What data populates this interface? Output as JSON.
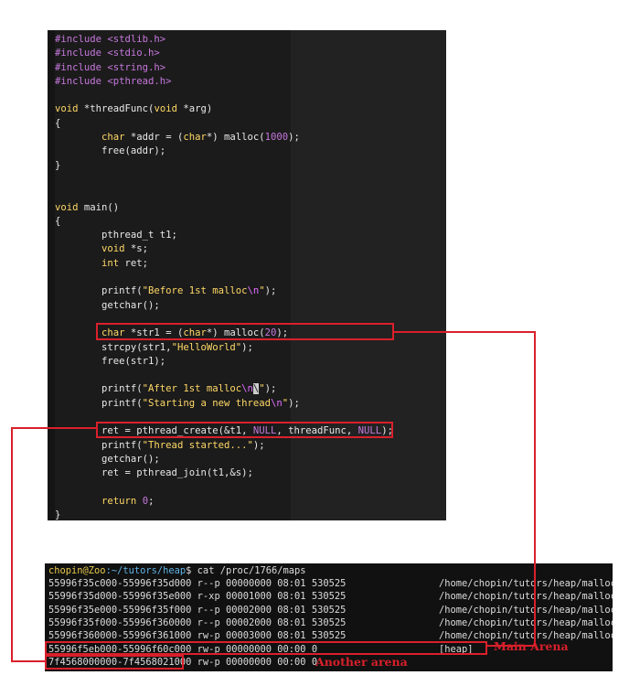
{
  "code_lines": [
    [
      [
        "pre",
        "#include "
      ],
      [
        "hdr",
        "<stdlib.h>"
      ]
    ],
    [
      [
        "pre",
        "#include "
      ],
      [
        "hdr",
        "<stdio.h>"
      ]
    ],
    [
      [
        "pre",
        "#include "
      ],
      [
        "hdr",
        "<string.h>"
      ]
    ],
    [
      [
        "pre",
        "#include "
      ],
      [
        "hdr",
        "<pthread.h>"
      ]
    ],
    [],
    [
      [
        "kw",
        "void"
      ],
      [
        "plain",
        " *threadFunc("
      ],
      [
        "kw",
        "void"
      ],
      [
        "plain",
        " *arg)"
      ]
    ],
    [
      [
        "plain",
        "{"
      ]
    ],
    [
      [
        "plain",
        "        "
      ],
      [
        "type",
        "char"
      ],
      [
        "plain",
        " *addr = ("
      ],
      [
        "type",
        "char"
      ],
      [
        "plain",
        "*) malloc("
      ],
      [
        "num",
        "1000"
      ],
      [
        "plain",
        ");"
      ]
    ],
    [
      [
        "plain",
        "        free(addr);"
      ]
    ],
    [
      [
        "plain",
        "}"
      ]
    ],
    [],
    [],
    [
      [
        "kw",
        "void"
      ],
      [
        "plain",
        " main()"
      ]
    ],
    [
      [
        "plain",
        "{"
      ]
    ],
    [
      [
        "plain",
        "        pthread_t t1;"
      ]
    ],
    [
      [
        "plain",
        "        "
      ],
      [
        "kw",
        "void"
      ],
      [
        "plain",
        " *s;"
      ]
    ],
    [
      [
        "plain",
        "        "
      ],
      [
        "kw",
        "int"
      ],
      [
        "plain",
        " ret;"
      ]
    ],
    [],
    [
      [
        "plain",
        "        printf("
      ],
      [
        "str",
        "\"Before 1st malloc"
      ],
      [
        "esc",
        "\\n"
      ],
      [
        "str",
        "\""
      ],
      [
        "plain",
        ");"
      ]
    ],
    [
      [
        "plain",
        "        getchar();"
      ]
    ],
    [],
    [
      [
        "plain",
        "        "
      ],
      [
        "type",
        "char"
      ],
      [
        "plain",
        " *str1 = ("
      ],
      [
        "type",
        "char"
      ],
      [
        "plain",
        "*) malloc("
      ],
      [
        "num",
        "20"
      ],
      [
        "plain",
        ");"
      ]
    ],
    [
      [
        "plain",
        "        strcpy(str1,"
      ],
      [
        "str",
        "\"HelloWorld\""
      ],
      [
        "plain",
        ");"
      ]
    ],
    [
      [
        "plain",
        "        free(str1);"
      ]
    ],
    [],
    [
      [
        "plain",
        "        printf("
      ],
      [
        "str",
        "\"After 1st malloc"
      ],
      [
        "esc",
        "\\n"
      ],
      [
        "cursor",
        "\\"
      ],
      [
        "str",
        "\""
      ],
      [
        "plain",
        ");"
      ]
    ],
    [
      [
        "plain",
        "        printf("
      ],
      [
        "str",
        "\"Starting a new thread"
      ],
      [
        "esc",
        "\\n"
      ],
      [
        "str",
        "\""
      ],
      [
        "plain",
        ");"
      ]
    ],
    [],
    [
      [
        "plain",
        "        ret = pthread_create(&t1, "
      ],
      [
        "nul",
        "NULL"
      ],
      [
        "plain",
        ", threadFunc, "
      ],
      [
        "nul",
        "NULL"
      ],
      [
        "plain",
        ");"
      ]
    ],
    [
      [
        "plain",
        "        printf("
      ],
      [
        "str",
        "\"Thread started...\""
      ],
      [
        "plain",
        ");"
      ]
    ],
    [
      [
        "plain",
        "        getchar();"
      ]
    ],
    [
      [
        "plain",
        "        ret = pthread_join(t1,&s);"
      ]
    ],
    [],
    [
      [
        "plain",
        "        "
      ],
      [
        "kw",
        "return"
      ],
      [
        "plain",
        " "
      ],
      [
        "num",
        "0"
      ],
      [
        "plain",
        ";"
      ]
    ],
    [
      [
        "plain",
        "}"
      ]
    ]
  ],
  "terminal": {
    "prompt_user": "chopin@Zoo",
    "prompt_path": ":~/tutors/heap",
    "prompt_end": "$",
    "command": " cat /proc/1766/maps",
    "rows": [
      {
        "range": "55996f35c000-55996f35d000",
        "perms": "r--p",
        "offset": "00000000",
        "dev": "08:01",
        "inode": "530525",
        "path": "/home/chopin/tutors/heap/malloc"
      },
      {
        "range": "55996f35d000-55996f35e000",
        "perms": "r-xp",
        "offset": "00001000",
        "dev": "08:01",
        "inode": "530525",
        "path": "/home/chopin/tutors/heap/malloc"
      },
      {
        "range": "55996f35e000-55996f35f000",
        "perms": "r--p",
        "offset": "00002000",
        "dev": "08:01",
        "inode": "530525",
        "path": "/home/chopin/tutors/heap/malloc"
      },
      {
        "range": "55996f35f000-55996f360000",
        "perms": "r--p",
        "offset": "00002000",
        "dev": "08:01",
        "inode": "530525",
        "path": "/home/chopin/tutors/heap/malloc"
      },
      {
        "range": "55996f360000-55996f361000",
        "perms": "rw-p",
        "offset": "00003000",
        "dev": "08:01",
        "inode": "530525",
        "path": "/home/chopin/tutors/heap/malloc"
      },
      {
        "range": "55996f5eb000-55996f60c000",
        "perms": "rw-p",
        "offset": "00000000",
        "dev": "00:00",
        "inode": "0",
        "path": "[heap]"
      },
      {
        "range": "7f4568000000-7f4568021000",
        "perms": "rw-p",
        "offset": "00000000",
        "dev": "00:00",
        "inode": "0",
        "path": ""
      }
    ]
  },
  "annotations": {
    "main_arena": "Main Arena",
    "another_arena": "Another arena",
    "color": "#d9202b"
  },
  "colors": {
    "editor_bg": "#1b1b1b",
    "terminal_bg": "#111111",
    "preprocessor": "#c678dd",
    "keyword": "#ffd866",
    "plain_text": "#e8e8e8"
  }
}
